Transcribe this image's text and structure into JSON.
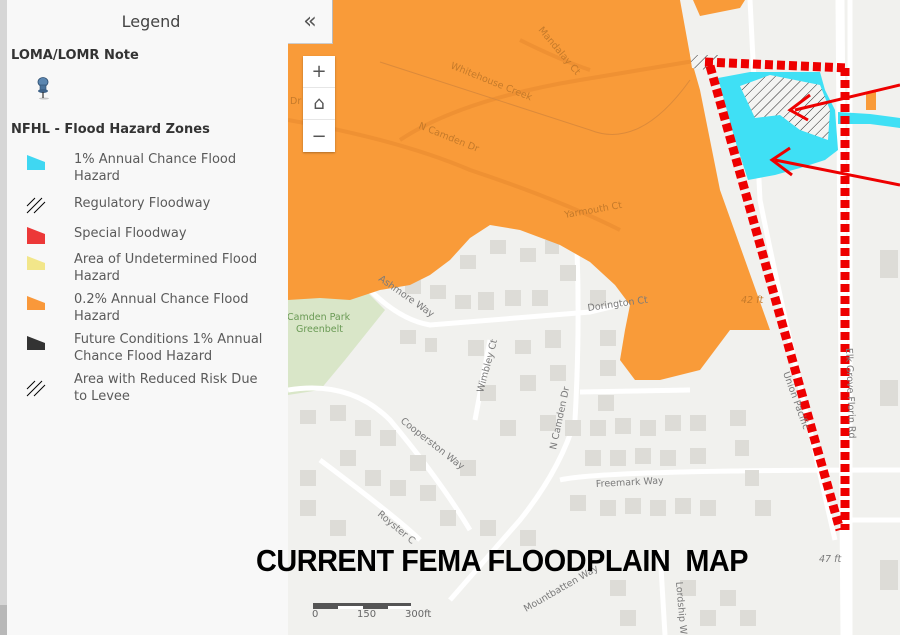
{
  "legend": {
    "title": "Legend",
    "loma_section": "LOMA/LOMR Note",
    "nfhl_section": "NFHL - Flood Hazard Zones",
    "items": [
      {
        "label": "1% Annual Chance Flood Hazard",
        "symbol": "fill",
        "color": "#3fd7f2"
      },
      {
        "label": "Regulatory Floodway",
        "symbol": "hatch",
        "color": "#000000"
      },
      {
        "label": "Special Floodway",
        "symbol": "fill",
        "color": "#ec3838"
      },
      {
        "label": "Area of Undetermined Flood Hazard",
        "symbol": "fill",
        "color": "#f2e68a"
      },
      {
        "label": "0.2% Annual Chance Flood Hazard",
        "symbol": "fill",
        "color": "#f9983a"
      },
      {
        "label": "Future Conditions 1% Annual Chance Flood Hazard",
        "symbol": "fill",
        "color": "#333333"
      },
      {
        "label": "Area with Reduced Risk Due to Levee",
        "symbol": "hatch",
        "color": "#000000"
      }
    ]
  },
  "controls": {
    "collapse_icon": "«",
    "zoom_in": "+",
    "home_icon": "⌂",
    "zoom_out": "−"
  },
  "map": {
    "overlay_title": "CURRENT FEMA FLOODPLAIN  MAP",
    "colors": {
      "flood_02": "#f99b39",
      "flood_1": "#3fe0f5",
      "annotation": "#ee0000",
      "park": "#d9e6c8",
      "base": "#f1f1ee"
    },
    "streets": {
      "mandalay": "Mandalay Ct",
      "whitehouse": "Whitehouse Creek",
      "camden_top": "N Camden Dr",
      "dr_left": "Dr",
      "yarmouth": "Yarmouth Ct",
      "ashmore": "Ashmore Way",
      "dorington": "Dorington Ct",
      "park": [
        "Camden Park",
        "Greenbelt"
      ],
      "wimbley": "Wimbley Ct",
      "camden_bottom": "N Camden Dr",
      "cooperston": "Cooperston Way",
      "freemark": "Freemark Way",
      "royster": "Royster C",
      "mountbatten": "Mountbatten Way",
      "lordship": "Lordship W",
      "union_pacific": "Union Pacific",
      "elk_grove": "Elk Grove Florin Rd"
    },
    "elevations": [
      "42 ft",
      "47 ft"
    ]
  },
  "scalebar": {
    "labels": [
      "0",
      "150",
      "300ft"
    ]
  }
}
